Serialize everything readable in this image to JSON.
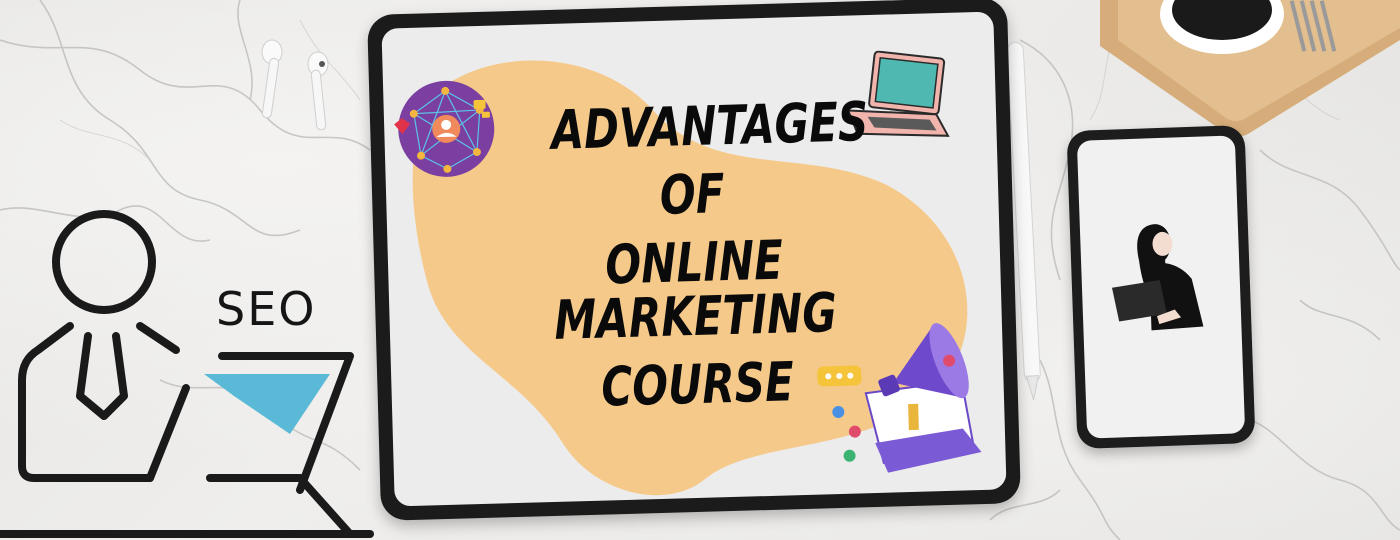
{
  "headline": {
    "line1": "ADVANTAGES",
    "line2": "OF",
    "line3": "ONLINE MARKETING",
    "line4": "COURSE"
  },
  "seo_label": "SEO",
  "colors": {
    "blob": "#f5c98a",
    "tablet_frame": "#1b1b1b",
    "screen": "#ececec",
    "accent_purple": "#7b4cc9",
    "accent_teal": "#4fb7d3",
    "laptop_pink": "#f2b5ad"
  },
  "icons": [
    "earbuds-icon",
    "stylus-icon",
    "laptop-icon",
    "network-icon",
    "megaphone-icon",
    "seo-person-icon",
    "woman-laptop-icon",
    "coffee-cup-icon",
    "fork-icon",
    "tray-icon"
  ]
}
